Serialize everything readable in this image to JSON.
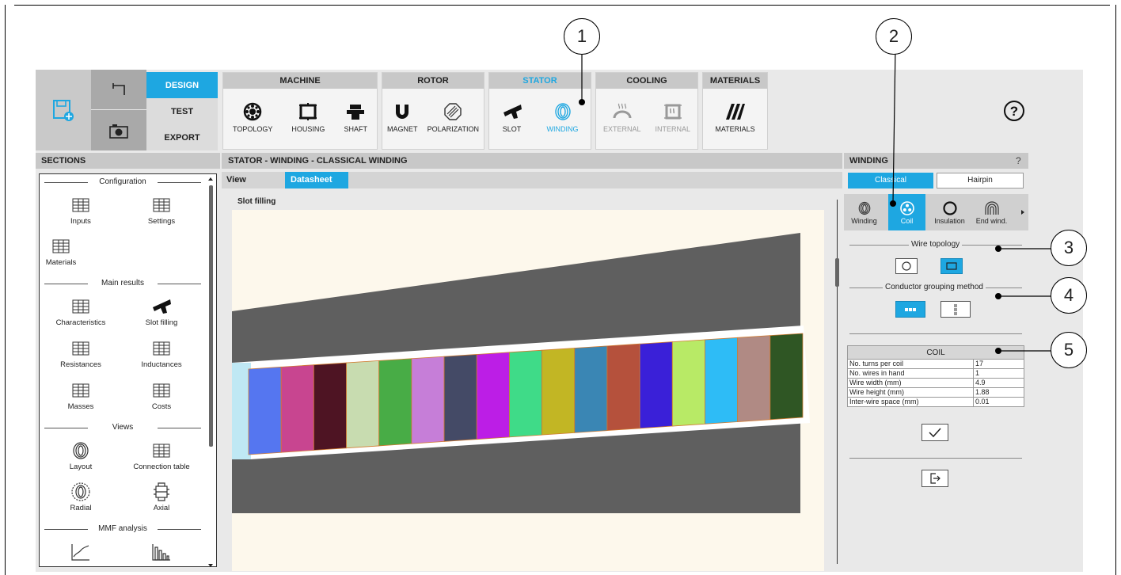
{
  "ribbon": {
    "modes": [
      {
        "label": "DESIGN",
        "active": true
      },
      {
        "label": "TEST",
        "active": false
      },
      {
        "label": "EXPORT",
        "active": false
      }
    ],
    "groups": {
      "machine": {
        "title": "MACHINE",
        "items": [
          "TOPOLOGY",
          "HOUSING",
          "SHAFT"
        ]
      },
      "rotor": {
        "title": "ROTOR",
        "items": [
          "MAGNET",
          "POLARIZATION"
        ]
      },
      "stator": {
        "title": "STATOR",
        "items": [
          "SLOT",
          "WINDING"
        ],
        "active_item": "WINDING"
      },
      "cooling": {
        "title": "COOLING",
        "items": [
          "EXTERNAL",
          "INTERNAL"
        ],
        "disabled": true
      },
      "materials": {
        "title": "MATERIALS",
        "items": [
          "MATERIALS"
        ]
      }
    },
    "help_icon": "question-circle-icon"
  },
  "sections": {
    "title": "SECTIONS",
    "groups": [
      {
        "title": "Configuration",
        "items": [
          "Inputs",
          "Settings",
          "Materials"
        ]
      },
      {
        "title": "Main results",
        "items": [
          "Characteristics",
          "Slot filling",
          "Resistances",
          "Inductances",
          "Masses",
          "Costs"
        ]
      },
      {
        "title": "Views",
        "items": [
          "Layout",
          "Connection table",
          "Radial",
          "Axial"
        ]
      },
      {
        "title": "MMF analysis",
        "items": []
      }
    ]
  },
  "center": {
    "title": "STATOR - WINDING - CLASSICAL WINDING",
    "tabs": {
      "view": "View",
      "datasheet": "Datasheet"
    },
    "view_title": "Slot filling",
    "conductor_colors": [
      "#5576f0",
      "#c84590",
      "#4e1423",
      "#c8dcb0",
      "#48ac46",
      "#c67ed8",
      "#444a66",
      "#bc1ee6",
      "#3fdb88",
      "#c2b624",
      "#3a86b4",
      "#b5513c",
      "#3a20d8",
      "#b8ea66",
      "#2ebcf6",
      "#b08a84",
      "#2f5624"
    ],
    "colors": {
      "background": "#fdf8ec",
      "iron": "#5f5f5f",
      "insulation": "#ffffff",
      "wedge": "#bfe8f4",
      "conductor_border": "#d07a30"
    }
  },
  "winding": {
    "title": "WINDING",
    "help": "?",
    "types": {
      "classical": "Classical",
      "hairpin": "Hairpin"
    },
    "subtabs": [
      "Winding",
      "Coil",
      "Insulation",
      "End wind."
    ],
    "active_subtab": "Coil",
    "wire_topology": "Wire topology",
    "conductor_grouping": "Conductor grouping method",
    "coil": {
      "header": "COIL",
      "rows": [
        {
          "label": "No. turns per coil",
          "value": "17"
        },
        {
          "label": "No. wires in hand",
          "value": "1"
        },
        {
          "label": "Wire width (mm)",
          "value": "4.9"
        },
        {
          "label": "Wire height (mm)",
          "value": "1.88"
        },
        {
          "label": "Inter-wire space (mm)",
          "value": "0.01"
        }
      ]
    }
  },
  "callouts": [
    "1",
    "2",
    "3",
    "4",
    "5"
  ],
  "accent": "#1ea7e1"
}
